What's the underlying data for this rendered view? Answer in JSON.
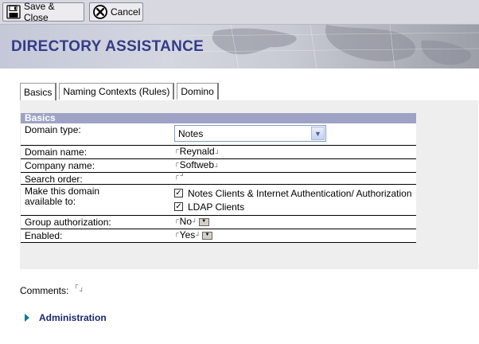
{
  "toolbar": {
    "save_label": "Save & Close",
    "cancel_label": "Cancel"
  },
  "banner": {
    "title": "DIRECTORY ASSISTANCE"
  },
  "tabs": [
    {
      "label": "Basics",
      "active": true
    },
    {
      "label": "Naming Contexts (Rules)",
      "active": false
    },
    {
      "label": "Domino",
      "active": false
    }
  ],
  "section": {
    "title": "Basics"
  },
  "form": {
    "domain_type": {
      "label": "Domain type:",
      "value": "Notes"
    },
    "domain_name": {
      "label": "Domain name:",
      "value": "Reynald"
    },
    "company_name": {
      "label": "Company name:",
      "value": "Softweb"
    },
    "search_order": {
      "label": "Search order:",
      "value": ""
    },
    "available_to": {
      "label": "Make this domain available to:",
      "options": [
        {
          "label": "Notes Clients & Internet Authentication/ Authorization",
          "checked": true
        },
        {
          "label": "LDAP Clients",
          "checked": true
        }
      ]
    },
    "group_authorization": {
      "label": "Group authorization:",
      "value": "No"
    },
    "enabled": {
      "label": "Enabled:",
      "value": "Yes"
    }
  },
  "comments": {
    "label": "Comments:",
    "value": ""
  },
  "administration": {
    "label": "Administration"
  },
  "colors": {
    "banner_title": "#343c88",
    "section_header": "#9ea2c4",
    "twisty": "#0e7b8c"
  }
}
